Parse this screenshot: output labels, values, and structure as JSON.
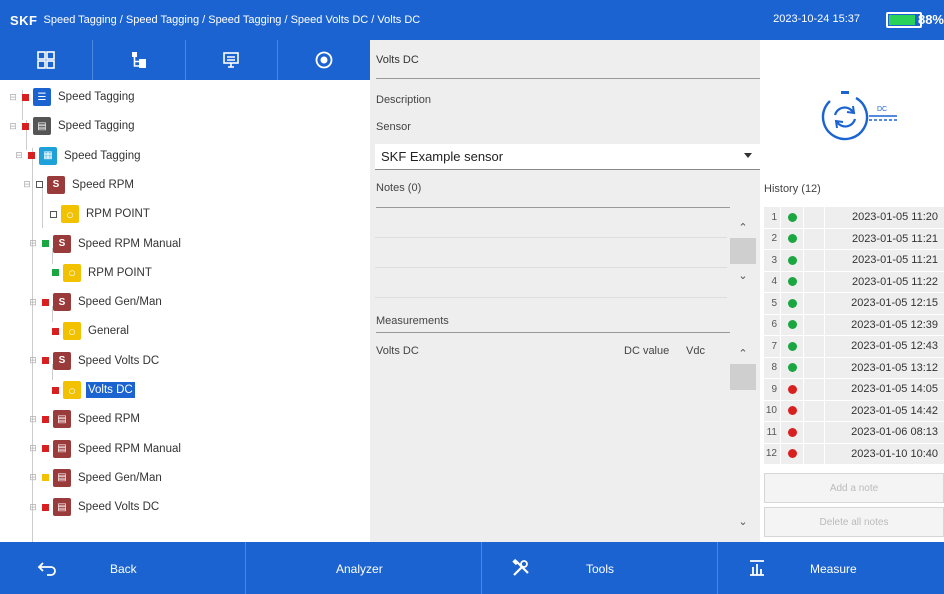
{
  "header": {
    "logo": "SKF",
    "breadcrumb": "Speed Tagging / Speed Tagging / Speed Tagging / Speed Volts DC / Volts DC",
    "datetime": "2023-10-24 15:37",
    "battery_percent": 88,
    "battery_label": "88%",
    "colors": {
      "bar": "#1c63d2",
      "battery_fill": "#2bd25a"
    }
  },
  "tabs": [
    {
      "icon": "grid-icon"
    },
    {
      "icon": "machine-tree-icon"
    },
    {
      "icon": "monitor-icon"
    },
    {
      "icon": "record-icon"
    }
  ],
  "tree": [
    {
      "label": "Speed Tagging",
      "status": "red",
      "icon": "server-icon"
    },
    {
      "label": "Speed Tagging",
      "status": "red",
      "icon": "device-icon"
    },
    {
      "label": "Speed Tagging",
      "status": "red",
      "icon": "panel-icon"
    },
    {
      "label": "Speed RPM",
      "status": "none",
      "icon": "speed-sensor-icon"
    },
    {
      "label": "RPM POINT",
      "status": "none",
      "icon": "point-icon"
    },
    {
      "label": "Speed RPM Manual",
      "status": "green",
      "icon": "speed-sensor-icon"
    },
    {
      "label": "RPM POINT",
      "status": "green",
      "icon": "point-icon"
    },
    {
      "label": "Speed Gen/Man",
      "status": "red",
      "icon": "speed-sensor-icon"
    },
    {
      "label": "General",
      "status": "red",
      "icon": "point-icon"
    },
    {
      "label": "Speed Volts DC",
      "status": "red",
      "icon": "speed-sensor-icon"
    },
    {
      "label": "Volts DC",
      "status": "red",
      "icon": "point-icon",
      "selected": true
    },
    {
      "label": "Speed RPM",
      "status": "red",
      "icon": "machine-icon"
    },
    {
      "label": "Speed RPM Manual",
      "status": "red",
      "icon": "machine-icon"
    },
    {
      "label": "Speed Gen/Man",
      "status": "yellow",
      "icon": "machine-icon"
    },
    {
      "label": "Speed Volts DC",
      "status": "red",
      "icon": "machine-icon"
    }
  ],
  "detail": {
    "title": "Volts DC",
    "description_label": "Description",
    "sensor_label": "Sensor",
    "sensor_value": "SKF Example sensor",
    "notes_label": "Notes (0)",
    "measurements_label": "Measurements",
    "measurement": {
      "name": "Volts DC",
      "type": "DC value",
      "unit": "Vdc"
    }
  },
  "sensor_icon": {
    "label": "DC",
    "name": "dc-measurement-icon"
  },
  "history": {
    "title": "History (12)",
    "rows": [
      {
        "n": "1",
        "status": "green",
        "date": "2023-01-05 11:20"
      },
      {
        "n": "2",
        "status": "green",
        "date": "2023-01-05 11:21"
      },
      {
        "n": "3",
        "status": "green",
        "date": "2023-01-05 11:21"
      },
      {
        "n": "4",
        "status": "green",
        "date": "2023-01-05 11:22"
      },
      {
        "n": "5",
        "status": "green",
        "date": "2023-01-05 12:15"
      },
      {
        "n": "6",
        "status": "green",
        "date": "2023-01-05 12:39"
      },
      {
        "n": "7",
        "status": "green",
        "date": "2023-01-05 12:43"
      },
      {
        "n": "8",
        "status": "green",
        "date": "2023-01-05 13:12"
      },
      {
        "n": "9",
        "status": "red",
        "date": "2023-01-05 14:05"
      },
      {
        "n": "10",
        "status": "red",
        "date": "2023-01-05 14:42"
      },
      {
        "n": "11",
        "status": "red",
        "date": "2023-01-06 08:13"
      },
      {
        "n": "12",
        "status": "red",
        "date": "2023-01-10 10:40"
      }
    ],
    "add_note_label": "Add a note",
    "delete_notes_label": "Delete all notes"
  },
  "footer": {
    "back_label": "Back",
    "analyzer_label": "Analyzer",
    "tools_label": "Tools",
    "measure_label": "Measure"
  },
  "colors": {
    "red": "#d92020",
    "green": "#1aa640",
    "yellow": "#f2c200"
  }
}
